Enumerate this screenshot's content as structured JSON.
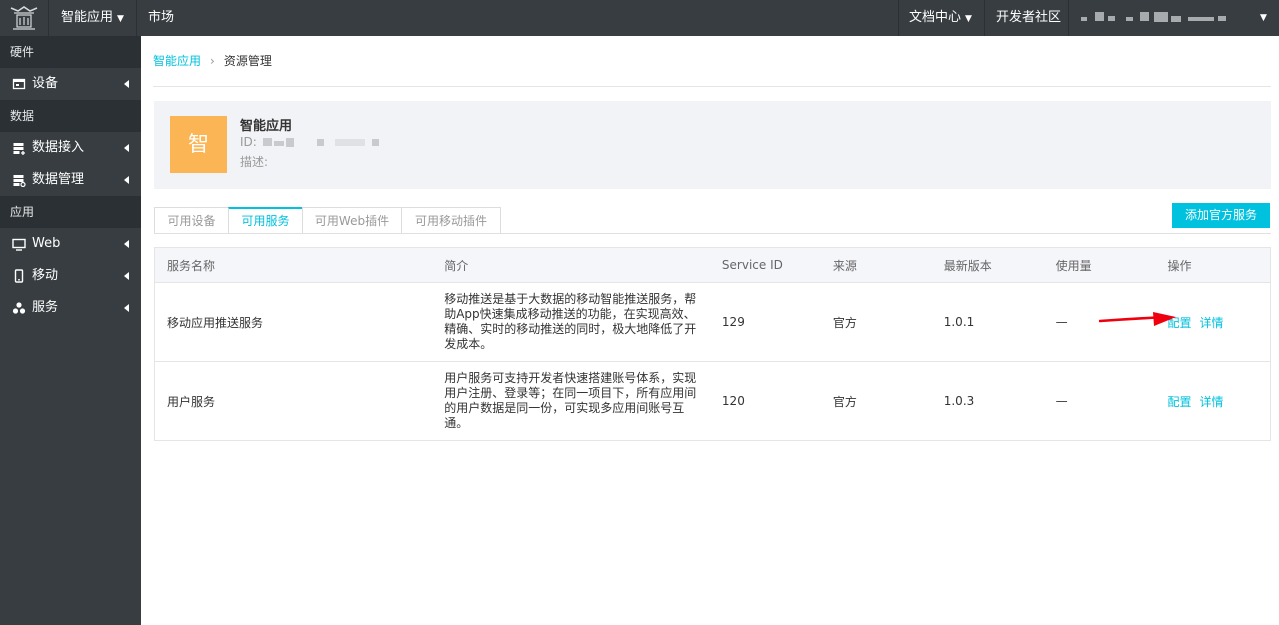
{
  "topbar": {
    "app_menu": "智能应用",
    "market": "市场",
    "docs": "文档中心",
    "community": "开发者社区"
  },
  "sidebar": {
    "groups": [
      {
        "label": "硬件",
        "items": [
          {
            "label": "设备",
            "icon": "device-icon"
          }
        ]
      },
      {
        "label": "数据",
        "items": [
          {
            "label": "数据接入",
            "icon": "data-access-icon"
          },
          {
            "label": "数据管理",
            "icon": "data-manage-icon"
          }
        ]
      },
      {
        "label": "应用",
        "items": [
          {
            "label": "Web",
            "icon": "monitor-icon"
          },
          {
            "label": "移动",
            "icon": "mobile-icon"
          },
          {
            "label": "服务",
            "icon": "service-icon"
          }
        ]
      }
    ]
  },
  "breadcrumb": {
    "root": "智能应用",
    "current": "资源管理"
  },
  "app": {
    "avatar_text": "智",
    "name": "智能应用",
    "id_label": "ID:",
    "desc_label": "描述:"
  },
  "tabs": [
    "可用设备",
    "可用服务",
    "可用Web插件",
    "可用移动插件"
  ],
  "active_tab": "可用服务",
  "add_button": "添加官方服务",
  "table": {
    "headers": [
      "服务名称",
      "简介",
      "Service ID",
      "来源",
      "最新版本",
      "使用量",
      "操作"
    ],
    "rows": [
      {
        "name": "移动应用推送服务",
        "intro": "移动推送是基于大数据的移动智能推送服务，帮助App快速集成移动推送的功能，在实现高效、精确、实时的移动推送的同时，极大地降低了开发成本。",
        "service_id": "129",
        "source": "官方",
        "version": "1.0.1",
        "usage": "—",
        "op_config": "配置",
        "op_detail": "详情"
      },
      {
        "name": "用户服务",
        "intro": "用户服务可支持开发者快速搭建账号体系，实现用户注册、登录等；在同一项目下，所有应用间的用户数据是同一份，可实现多应用间账号互通。",
        "service_id": "120",
        "source": "官方",
        "version": "1.0.3",
        "usage": "—",
        "op_config": "配置",
        "op_detail": "详情"
      }
    ]
  },
  "colors": {
    "accent": "#00c1de",
    "topbar": "#373d41",
    "avatar": "#fcb554",
    "annotation": "#f0000f"
  }
}
